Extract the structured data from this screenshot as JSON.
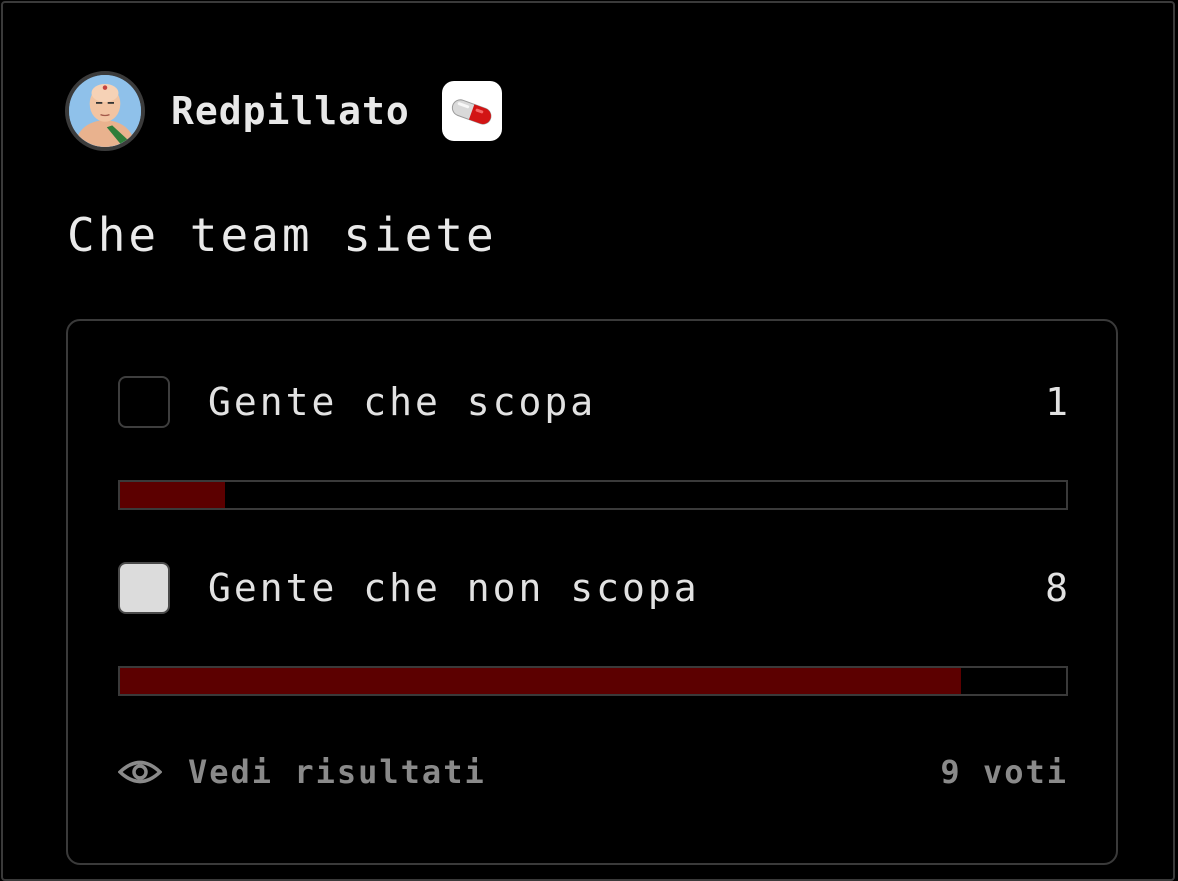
{
  "post": {
    "author": {
      "username": "Redpillato",
      "avatar_icon": "character-avatar",
      "badge_icon": "red-pill-icon"
    },
    "title": "Che team siete"
  },
  "poll": {
    "options": [
      {
        "label": "Gente che scopa",
        "count": "1",
        "checked": false,
        "fraction": 0.111
      },
      {
        "label": "Gente che non scopa",
        "count": "8",
        "checked": true,
        "fraction": 0.889
      }
    ],
    "results_link": "Vedi risultati",
    "total_votes": "9 voti"
  },
  "colors": {
    "bar_fill": "#5c0000",
    "background": "#000000",
    "border": "#3a3a3a"
  }
}
